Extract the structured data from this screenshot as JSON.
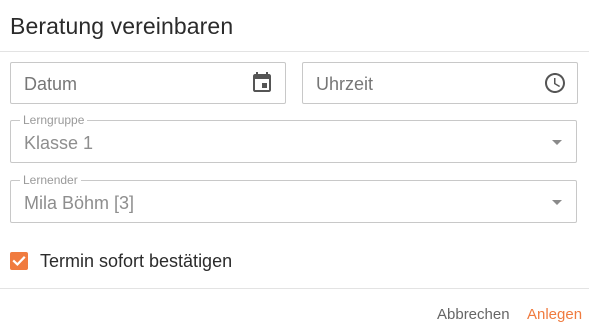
{
  "dialog": {
    "title": "Beratung vereinbaren"
  },
  "fields": {
    "datum": {
      "placeholder": "Datum",
      "icon": "calendar-icon"
    },
    "uhrzeit": {
      "placeholder": "Uhrzeit",
      "icon": "clock-icon"
    }
  },
  "selects": {
    "lerngruppe": {
      "label": "Lerngruppe",
      "value": "Klasse 1"
    },
    "lernender": {
      "label": "Lernender",
      "value": "Mila Böhm [3]"
    }
  },
  "confirm": {
    "label": "Termin sofort bestätigen",
    "checked": true
  },
  "actions": {
    "cancel": "Abbrechen",
    "save": "Anlegen"
  },
  "colors": {
    "accent": "#f07b3f"
  }
}
